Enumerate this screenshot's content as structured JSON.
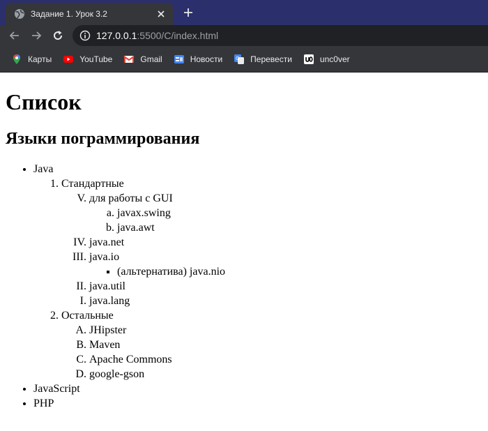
{
  "browser": {
    "tab_title": "Задание 1. Урок 3.2",
    "url_host": "127.0.0.1",
    "url_rest": ":5500/C/index.html",
    "bookmarks": [
      {
        "label": "Карты",
        "icon": "maps-pin-icon"
      },
      {
        "label": "YouTube",
        "icon": "youtube-icon"
      },
      {
        "label": "Gmail",
        "icon": "gmail-icon"
      },
      {
        "label": "Новости",
        "icon": "news-icon"
      },
      {
        "label": "Перевести",
        "icon": "translate-icon"
      },
      {
        "label": "unc0ver",
        "icon": "unc0ver-icon"
      }
    ]
  },
  "page": {
    "h1": "Список",
    "h2": "Языки пограммирования",
    "root": {
      "java": "Java",
      "standard": "Стандартные",
      "gui": "для работы с GUI",
      "swing": "javax.swing",
      "awt": "java.awt",
      "net": "java.net",
      "io": "java.io",
      "nio": "(альтернатива) java.nio",
      "util": "java.util",
      "lang": "java.lang",
      "others": "Остальные",
      "jhipster": "JHipster",
      "maven": "Maven",
      "commons": "Apache Commons",
      "gson": "google-gson",
      "javascript": "JavaScript",
      "php": "PHP"
    }
  }
}
